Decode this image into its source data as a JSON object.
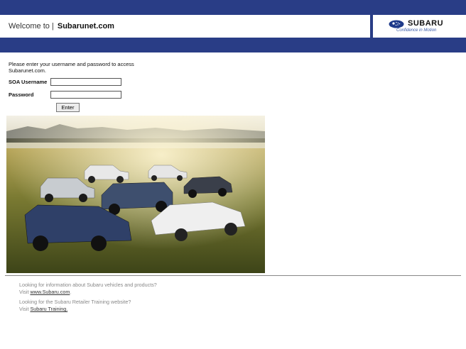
{
  "header": {
    "welcome_text": "Welcome to |",
    "site_name_bold": "Subaru",
    "site_name_rest": "net.com",
    "logo_word": "SUBARU",
    "logo_tagline": "Confidence in Motion"
  },
  "login": {
    "intro": "Please enter your username and password to access Subarunet.com.",
    "username_label": "SOA Username",
    "password_label": "Password",
    "username_value": "",
    "password_value": "",
    "submit_label": "Enter"
  },
  "footer": {
    "vehicles_question": "Looking for information about Subaru vehicles and products?",
    "vehicles_prefix": "Visit ",
    "vehicles_link": "www.Subaru.com",
    "vehicles_suffix": ".",
    "training_question": "Looking for the Subaru Retailer Training website?",
    "training_prefix": "Visit ",
    "training_link": "Subaru Training."
  },
  "colors": {
    "header_band": "#293d86",
    "logo_blue": "#1e3a8a"
  }
}
